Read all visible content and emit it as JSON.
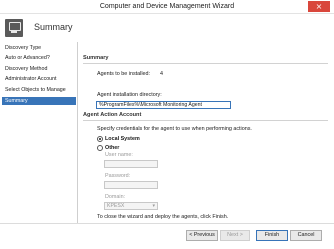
{
  "window": {
    "title": "Computer and Device Management Wizard",
    "close_glyph": "×"
  },
  "header": {
    "title": "Summary",
    "icon": "wizard-monitor-icon"
  },
  "sidebar": {
    "items": [
      {
        "label": "Discovery Type",
        "active": false
      },
      {
        "label": "Auto or Advanced?",
        "active": false
      },
      {
        "label": "Discovery Method",
        "active": false
      },
      {
        "label": "Administrator Account",
        "active": false
      },
      {
        "label": "Select Objects to Manage",
        "active": false
      },
      {
        "label": "Summary",
        "active": true
      }
    ]
  },
  "summary": {
    "heading": "Summary",
    "agents_label": "Agents to be installed:",
    "agents_count": "4",
    "install_dir_label": "Agent installation directory:",
    "install_dir_value": "%ProgramFiles%\\Microsoft Monitoring Agent"
  },
  "action_account": {
    "heading": "Agent Action Account",
    "description": "Specify credentials for the agent to use when performing actions.",
    "local_system_label": "Local System",
    "other_label": "Other",
    "selected": "Local System",
    "username_label": "User name:",
    "password_label": "Password:",
    "domain_label": "Domain:",
    "domain_value": "KPESX",
    "finish_note": "To close the wizard and deploy the agents, click Finish."
  },
  "footer": {
    "previous_label": "< Previous",
    "next_label": "Next >",
    "finish_label": "Finish",
    "cancel_label": "Cancel"
  },
  "colors": {
    "accent": "#3874b8",
    "close": "#d9473c"
  }
}
